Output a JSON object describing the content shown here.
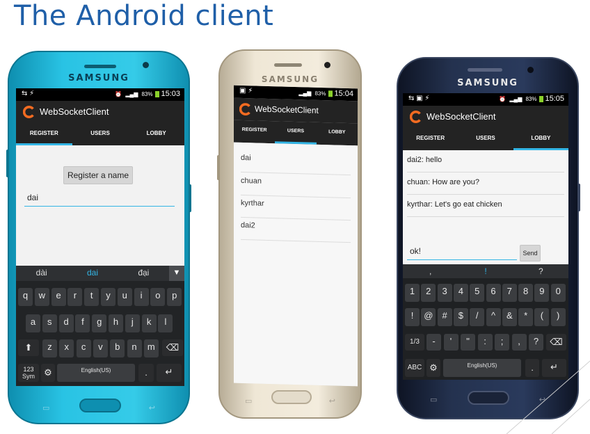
{
  "slide": {
    "title": "The Android client"
  },
  "brand": "SAMSUNG",
  "app": {
    "title": "WebSocketClient",
    "tabs": [
      "REGISTER",
      "USERS",
      "LOBBY"
    ]
  },
  "phones": [
    {
      "time": "15:03",
      "battery": "83%",
      "register_button": "Register a name",
      "name_input_value": "dai",
      "suggestions": [
        "dài",
        "dai",
        "đại"
      ],
      "keyboard_rows": [
        [
          "q",
          "w",
          "e",
          "r",
          "t",
          "y",
          "u",
          "i",
          "o",
          "p"
        ],
        [
          "a",
          "s",
          "d",
          "f",
          "g",
          "h",
          "j",
          "k",
          "l"
        ],
        [
          "z",
          "x",
          "c",
          "v",
          "b",
          "n",
          "m"
        ]
      ],
      "keys": {
        "sym": "123\nSym",
        "space": "English(US)",
        "shift": "⬆",
        "backspace": "⌫",
        "enter": "↵",
        "dot": "."
      }
    },
    {
      "time": "15:04",
      "battery": "83%",
      "users": [
        "dai",
        "chuan",
        "kyrthar",
        "dai2"
      ]
    },
    {
      "time": "15:05",
      "battery": "83%",
      "messages": [
        "dai2: hello",
        "chuan: How are you?",
        "kyrthar: Let's go eat chicken"
      ],
      "message_input_value": "ok!",
      "send_button": "Send",
      "suggestions": [
        ",",
        "!",
        "?"
      ],
      "keyboard_rows": [
        [
          "1",
          "2",
          "3",
          "4",
          "5",
          "6",
          "7",
          "8",
          "9",
          "0"
        ],
        [
          "!",
          "@",
          "#",
          "$",
          "/",
          "^",
          "&",
          "*",
          "(",
          ")"
        ],
        [
          "-",
          "'",
          "\"",
          ":",
          ";",
          ",",
          "?"
        ]
      ],
      "keys": {
        "mode": "1/3",
        "abc": "ABC",
        "space": "English(US)",
        "backspace": "⌫",
        "enter": "↵",
        "dot": "."
      }
    }
  ],
  "colors": {
    "title": "#1F5FA8",
    "phone1_body": "#1fb6d6",
    "phone2_body": "#d8cdb8",
    "phone3_body": "#1e2a44",
    "tab_indicator": "#33b5e5",
    "logo": "#f26b21"
  }
}
